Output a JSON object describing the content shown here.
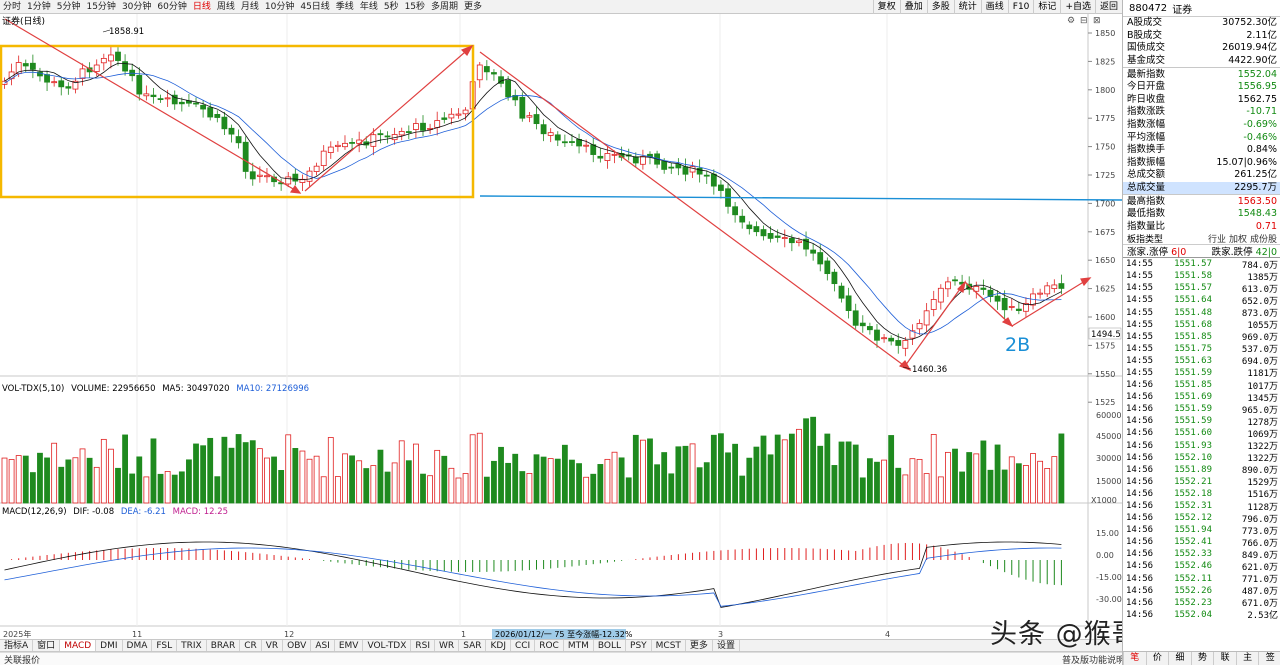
{
  "toolbar": {
    "timeframes": [
      "分时",
      "1分钟",
      "5分钟",
      "15分钟",
      "30分钟",
      "60分钟",
      "日线",
      "周线",
      "月线",
      "10分钟",
      "45日线",
      "季线",
      "年线",
      "5秒",
      "15秒",
      "多周期",
      "更多"
    ],
    "active_timeframe": "日线",
    "tools": [
      "复权",
      "叠加",
      "多股",
      "统计",
      "画线",
      "F10",
      "标记",
      "+自选",
      "返回"
    ]
  },
  "chart": {
    "title": "证券(日线)",
    "high_label": "1858.91",
    "low_label": "1460.36",
    "current_price_box": "1494.5",
    "annotation": "2B",
    "price_axis": [
      "1850",
      "1825",
      "1800",
      "1775",
      "1750",
      "1725",
      "1700",
      "1675",
      "1650",
      "1625",
      "1600",
      "1575",
      "1550",
      "1525"
    ],
    "volume_header": {
      "name": "VOL-TDX(5,10)",
      "volume": "VOLUME: 22956650",
      "ma5": "MA5: 30497020",
      "ma10": "MA10: 27126996"
    },
    "volume_axis": [
      "60000",
      "45000",
      "30000",
      "15000"
    ],
    "volume_unit": "X1000",
    "macd_header": {
      "name": "MACD(12,26,9)",
      "dif": "DIF: -0.08",
      "dea": "DEA: -6.21",
      "macd": "MACD: 12.25"
    },
    "macd_axis": [
      "15.00",
      "0.00",
      "-15.00",
      "-30.00"
    ],
    "date_axis": [
      "2025年",
      "11",
      "12",
      "1",
      "3",
      "4"
    ],
    "date_tooltip": "2026/01/12/一  75  至今涨幅-12.32%",
    "colors": {
      "up": "#e02020",
      "down": "#1f8a1f",
      "ma_black": "#111111",
      "ma_blue": "#2060d8",
      "box": "#f5b800",
      "hline": "#1a8fd6",
      "trend": "#e04040",
      "annotation": "#1a8fd6"
    }
  },
  "indicator_tabs": [
    "指标A",
    "窗口",
    "MACD",
    "DMI",
    "DMA",
    "FSL",
    "TRIX",
    "BRAR",
    "CR",
    "VR",
    "OBV",
    "ASI",
    "EMV",
    "VOL-TDX",
    "RSI",
    "WR",
    "SAR",
    "KDJ",
    "CCI",
    "ROC",
    "MTM",
    "BOLL",
    "PSY",
    "MCST",
    "更多",
    "设置"
  ],
  "active_indicator": "MACD",
  "bottom_strip": "关联报价",
  "help_link": "普及版功能说明",
  "watermark": "头条 @猴哥聊缠论",
  "panel": {
    "code": "880472",
    "name": "证券",
    "stats": [
      {
        "label": "A股成交",
        "value": "30752.30亿",
        "color": "#000000"
      },
      {
        "label": "B股成交",
        "value": "2.11亿",
        "color": "#000000"
      },
      {
        "label": "国债成交",
        "value": "26019.94亿",
        "color": "#000000"
      },
      {
        "label": "基金成交",
        "value": "4422.90亿",
        "color": "#000000"
      },
      {
        "label": "最新指数",
        "value": "1552.04",
        "color": "#128a12"
      },
      {
        "label": "今日开盘",
        "value": "1556.95",
        "color": "#128a12"
      },
      {
        "label": "昨日收盘",
        "value": "1562.75",
        "color": "#000000"
      },
      {
        "label": "指数涨跌",
        "value": "-10.71",
        "color": "#128a12"
      },
      {
        "label": "指数涨幅",
        "value": "-0.69%",
        "color": "#128a12"
      },
      {
        "label": "平均涨幅",
        "value": "-0.46%",
        "color": "#128a12"
      },
      {
        "label": "指数换手",
        "value": "0.84%",
        "color": "#000000"
      },
      {
        "label": "指数振幅",
        "value": "15.07|0.96%",
        "color": "#000000"
      },
      {
        "label": "总成交额",
        "value": "261.25亿",
        "color": "#000000"
      },
      {
        "label": "总成交量",
        "value": "2295.7万",
        "color": "#000000"
      },
      {
        "label": "最高指数",
        "value": "1563.50",
        "color": "#e00000"
      },
      {
        "label": "最低指数",
        "value": "1548.43",
        "color": "#128a12"
      },
      {
        "label": "指数量比",
        "value": "0.71",
        "color": "#e00000"
      }
    ],
    "sector_type_label": "板指类型",
    "sector_links": [
      "行业",
      "加权",
      "成份股"
    ],
    "breadth": {
      "up_label": "涨家.涨停",
      "up_value": "6|0",
      "down_label": "跌家.跌停",
      "down_value": "42|0"
    },
    "ticks": [
      [
        "14:55",
        "1551.57",
        "784.0万"
      ],
      [
        "14:55",
        "1551.58",
        "1385万"
      ],
      [
        "14:55",
        "1551.57",
        "613.0万"
      ],
      [
        "14:55",
        "1551.64",
        "652.0万"
      ],
      [
        "14:55",
        "1551.48",
        "873.0万"
      ],
      [
        "14:55",
        "1551.68",
        "1055万"
      ],
      [
        "14:55",
        "1551.85",
        "969.0万"
      ],
      [
        "14:55",
        "1551.75",
        "537.0万"
      ],
      [
        "14:55",
        "1551.63",
        "694.0万"
      ],
      [
        "14:55",
        "1551.59",
        "1181万"
      ],
      [
        "14:56",
        "1551.85",
        "1017万"
      ],
      [
        "14:56",
        "1551.69",
        "1345万"
      ],
      [
        "14:56",
        "1551.59",
        "965.0万"
      ],
      [
        "14:56",
        "1551.59",
        "1278万"
      ],
      [
        "14:56",
        "1551.60",
        "1069万"
      ],
      [
        "14:56",
        "1551.93",
        "1322万"
      ],
      [
        "14:56",
        "1552.10",
        "1322万"
      ],
      [
        "14:56",
        "1551.89",
        "890.0万"
      ],
      [
        "14:56",
        "1552.21",
        "1529万"
      ],
      [
        "14:56",
        "1552.18",
        "1516万"
      ],
      [
        "14:56",
        "1552.31",
        "1128万"
      ],
      [
        "14:56",
        "1552.12",
        "796.0万"
      ],
      [
        "14:56",
        "1551.94",
        "773.0万"
      ],
      [
        "14:56",
        "1552.41",
        "766.0万"
      ],
      [
        "14:56",
        "1552.33",
        "849.0万"
      ],
      [
        "14:56",
        "1552.46",
        "621.0万"
      ],
      [
        "14:56",
        "1552.11",
        "771.0万"
      ],
      [
        "14:56",
        "1552.26",
        "487.0万"
      ],
      [
        "14:56",
        "1552.23",
        "671.0万"
      ],
      [
        "14:56",
        "1552.04",
        "2.53亿"
      ]
    ],
    "footer_tabs": [
      "笔",
      "价",
      "细",
      "势",
      "联",
      "主",
      "签"
    ],
    "active_footer": "笔"
  }
}
